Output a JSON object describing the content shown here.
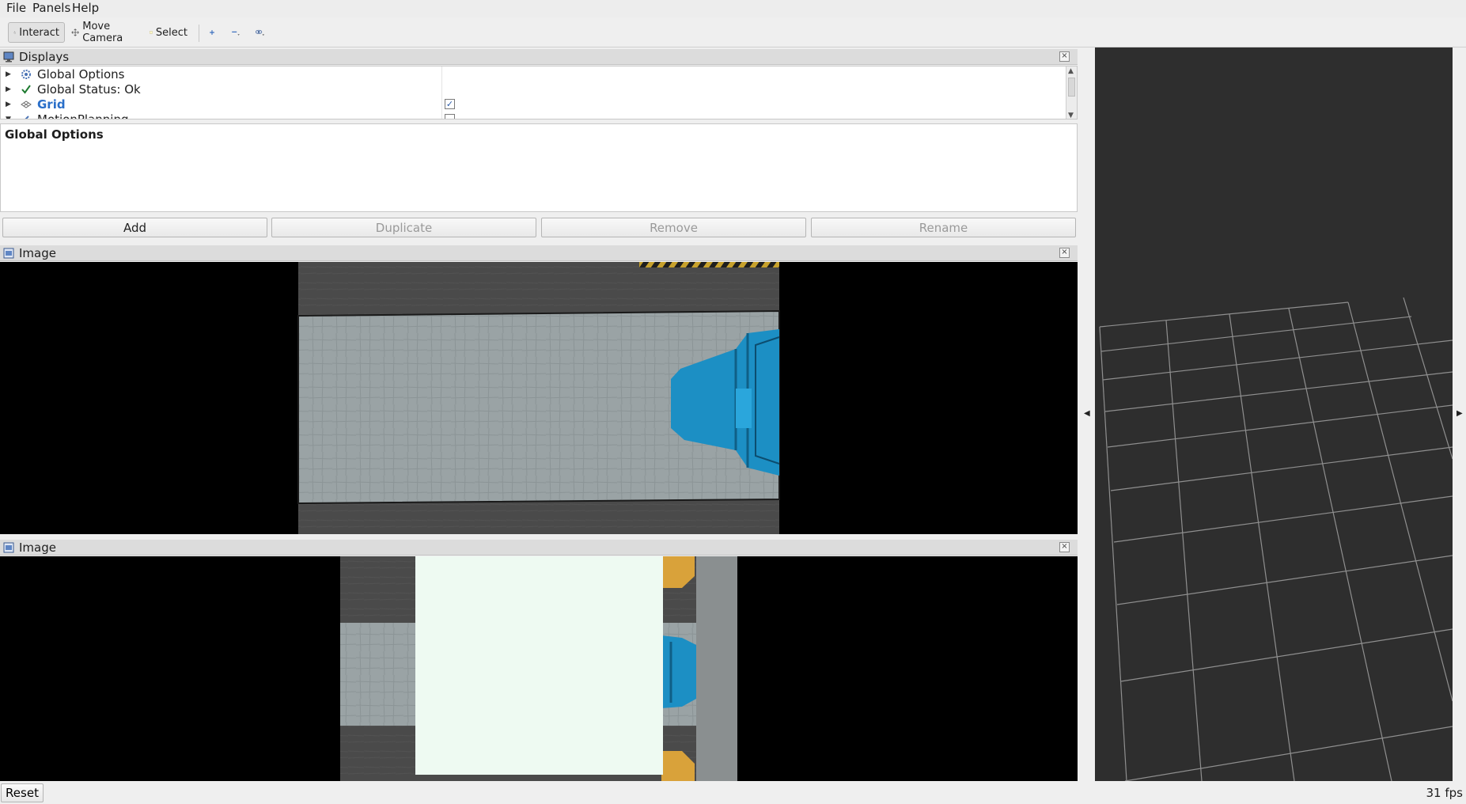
{
  "menu": {
    "file": "File",
    "panels": "Panels",
    "help": "Help"
  },
  "toolbar": {
    "interact": "Interact",
    "move_camera": "Move Camera",
    "select": "Select"
  },
  "displays_panel": {
    "title": "Displays",
    "items": [
      {
        "label": "Global Options",
        "icon": "gear-icon",
        "expanded": false
      },
      {
        "label": "Global Status: Ok",
        "icon": "check-icon",
        "expanded": false
      },
      {
        "label": "Grid",
        "icon": "grid-icon",
        "expanded": false,
        "checked": true
      },
      {
        "label": "MotionPlanning",
        "icon": "robot-icon",
        "expanded": true,
        "checked": false
      }
    ],
    "description_title": "Global Options"
  },
  "buttons": {
    "add": "Add",
    "duplicate": "Duplicate",
    "remove": "Remove",
    "rename": "Rename"
  },
  "image_panels": [
    {
      "title": "Image"
    },
    {
      "title": "Image"
    }
  ],
  "status": {
    "reset": "Reset",
    "fps": "31 fps"
  },
  "colors": {
    "bin_blue": "#1c8fc4",
    "render_bg": "#2e2e2e",
    "grid_line": "#8f8f8f",
    "grid_label_blue": "#2a6fc9"
  }
}
